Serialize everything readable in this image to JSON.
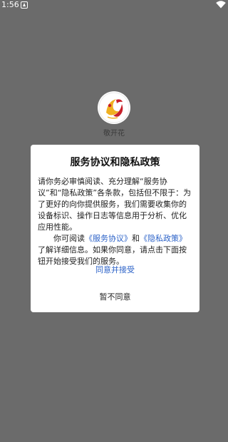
{
  "status_bar": {
    "time": "1:56"
  },
  "app": {
    "name": "敬开花"
  },
  "dialog": {
    "title": "服务协议和隐私政策",
    "paragraph1": "请你务必审慎阅读、充分理解“服务协议”和“隐私政策”各条款，包括但不限于：为了更好的向你提供服务，我们需要收集你的设备标识、操作日志等信息用于分析、优化应用性能。",
    "p2_before": "你可阅读",
    "link_terms": "《服务协议》",
    "p2_and": "和",
    "link_privacy": "《隐私政策》",
    "p2_after": "了解详细信息。如果你同意，请点击下面按钮开始接受我们的服务。",
    "agree_label": "同意并接受",
    "disagree_label": "暂不同意"
  },
  "colors": {
    "overlay": "#6b6b6b",
    "link": "#2d63c8",
    "logo_red": "#c8202a",
    "logo_gold": "#f0b020"
  },
  "icons": [
    "app-notification-icon",
    "wifi-icon",
    "app-logo-icon"
  ]
}
